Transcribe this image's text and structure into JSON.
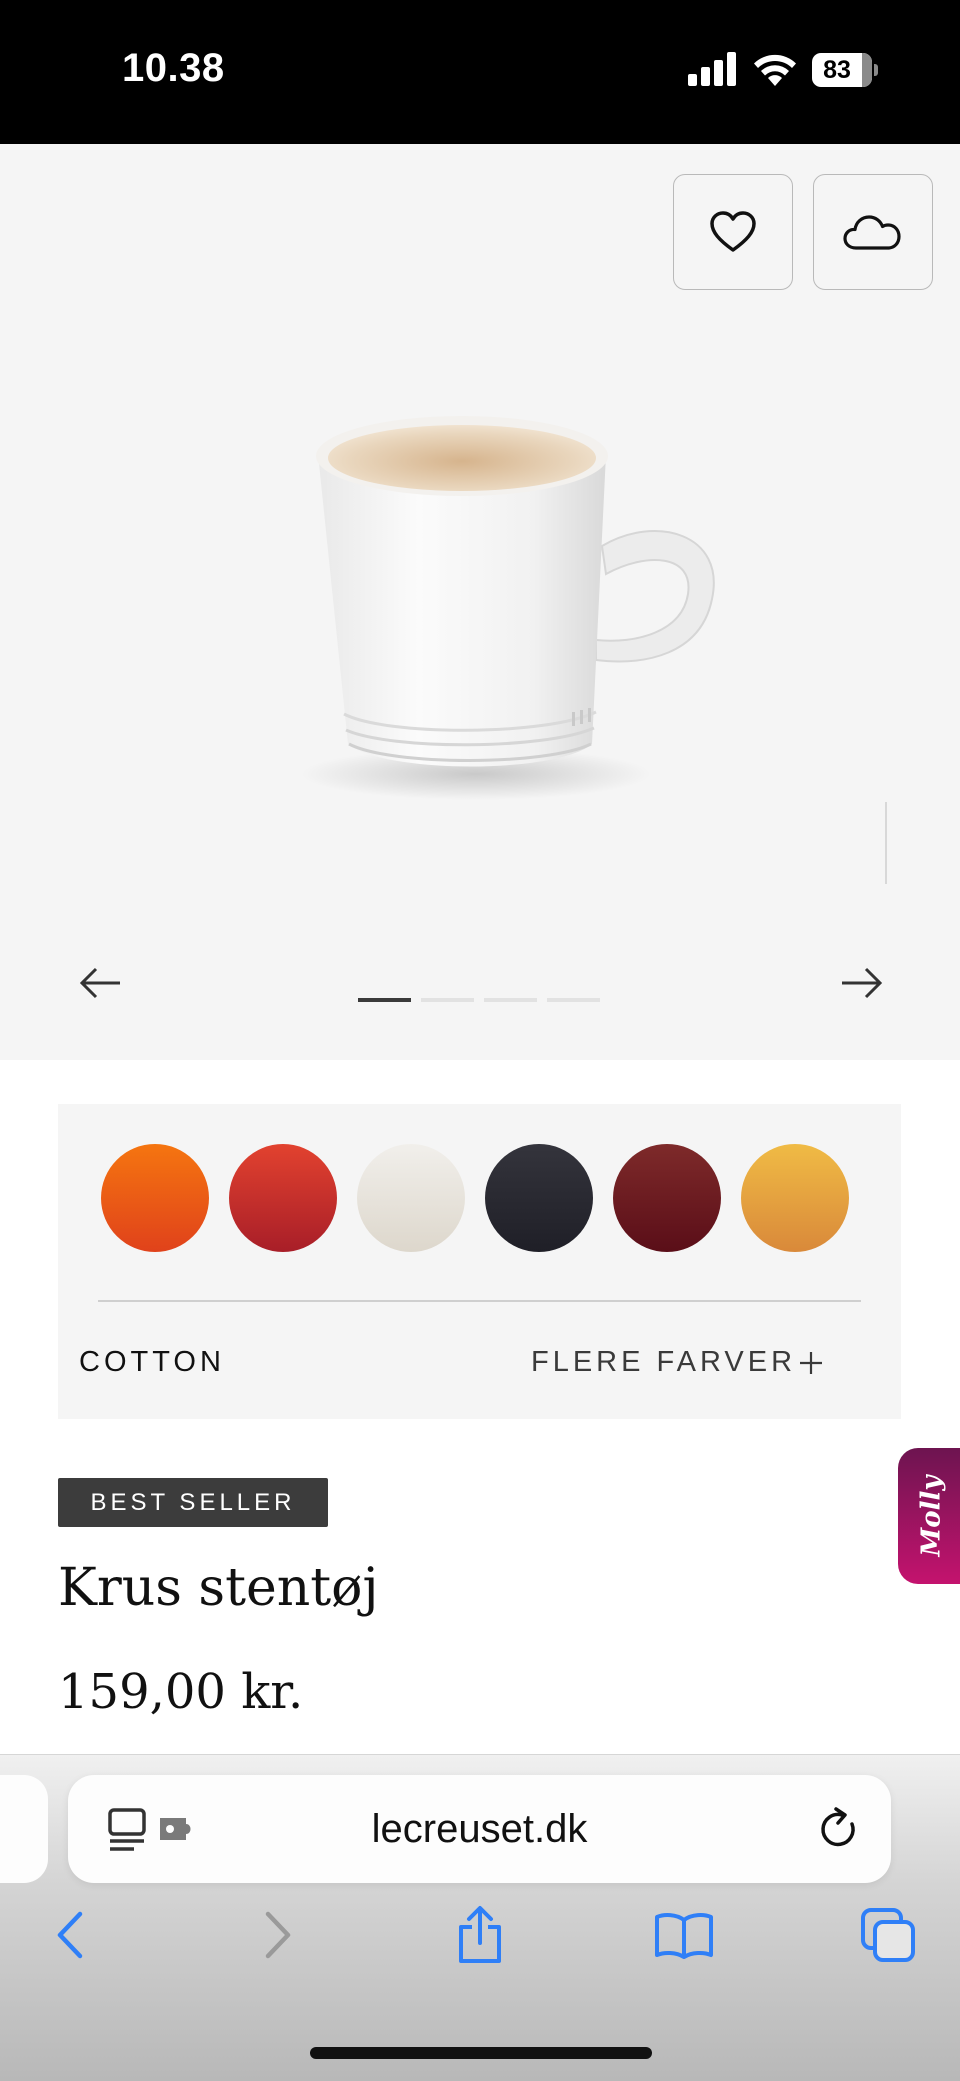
{
  "status_bar": {
    "time": "10.38",
    "battery_level": "83",
    "battery_fraction": 0.83
  },
  "gallery": {
    "wishlist_icon": "heart-icon",
    "cloud_icon": "cloud-icon",
    "image_description": "white stoneware mug",
    "prev_icon": "arrow-left-icon",
    "next_icon": "arrow-right-icon",
    "slide_count": 4,
    "active_slide": 1
  },
  "colors": {
    "swatches": [
      {
        "name": "orange",
        "top": "#f57510",
        "bottom": "#e0421b"
      },
      {
        "name": "red",
        "top": "#e2422f",
        "bottom": "#a81e28"
      },
      {
        "name": "cotton",
        "top": "#f1efeb",
        "bottom": "#ddd7cc"
      },
      {
        "name": "black",
        "top": "#34343c",
        "bottom": "#1f1f27"
      },
      {
        "name": "burgundy",
        "top": "#7e2a2a",
        "bottom": "#5a0e18"
      },
      {
        "name": "mustard",
        "top": "#f0bb45",
        "bottom": "#d9893a"
      }
    ],
    "selected_name": "COTTON",
    "more_colors_label": "FLERE FARVER",
    "plus_icon": "plus-icon"
  },
  "product": {
    "badge": "BEST SELLER",
    "title": "Krus stentøj",
    "price": "159,00 kr."
  },
  "chat_widget": {
    "label": "Molly"
  },
  "browser": {
    "url": "lecreuset.dk",
    "reader_icon": "page-settings-icon",
    "reload_icon": "reload-icon",
    "toolbar": [
      "back-icon",
      "forward-icon",
      "share-icon",
      "bookmarks-icon",
      "tabs-icon"
    ],
    "accent_color": "#2f7ff7",
    "disabled_color": "#9a9a9a"
  }
}
